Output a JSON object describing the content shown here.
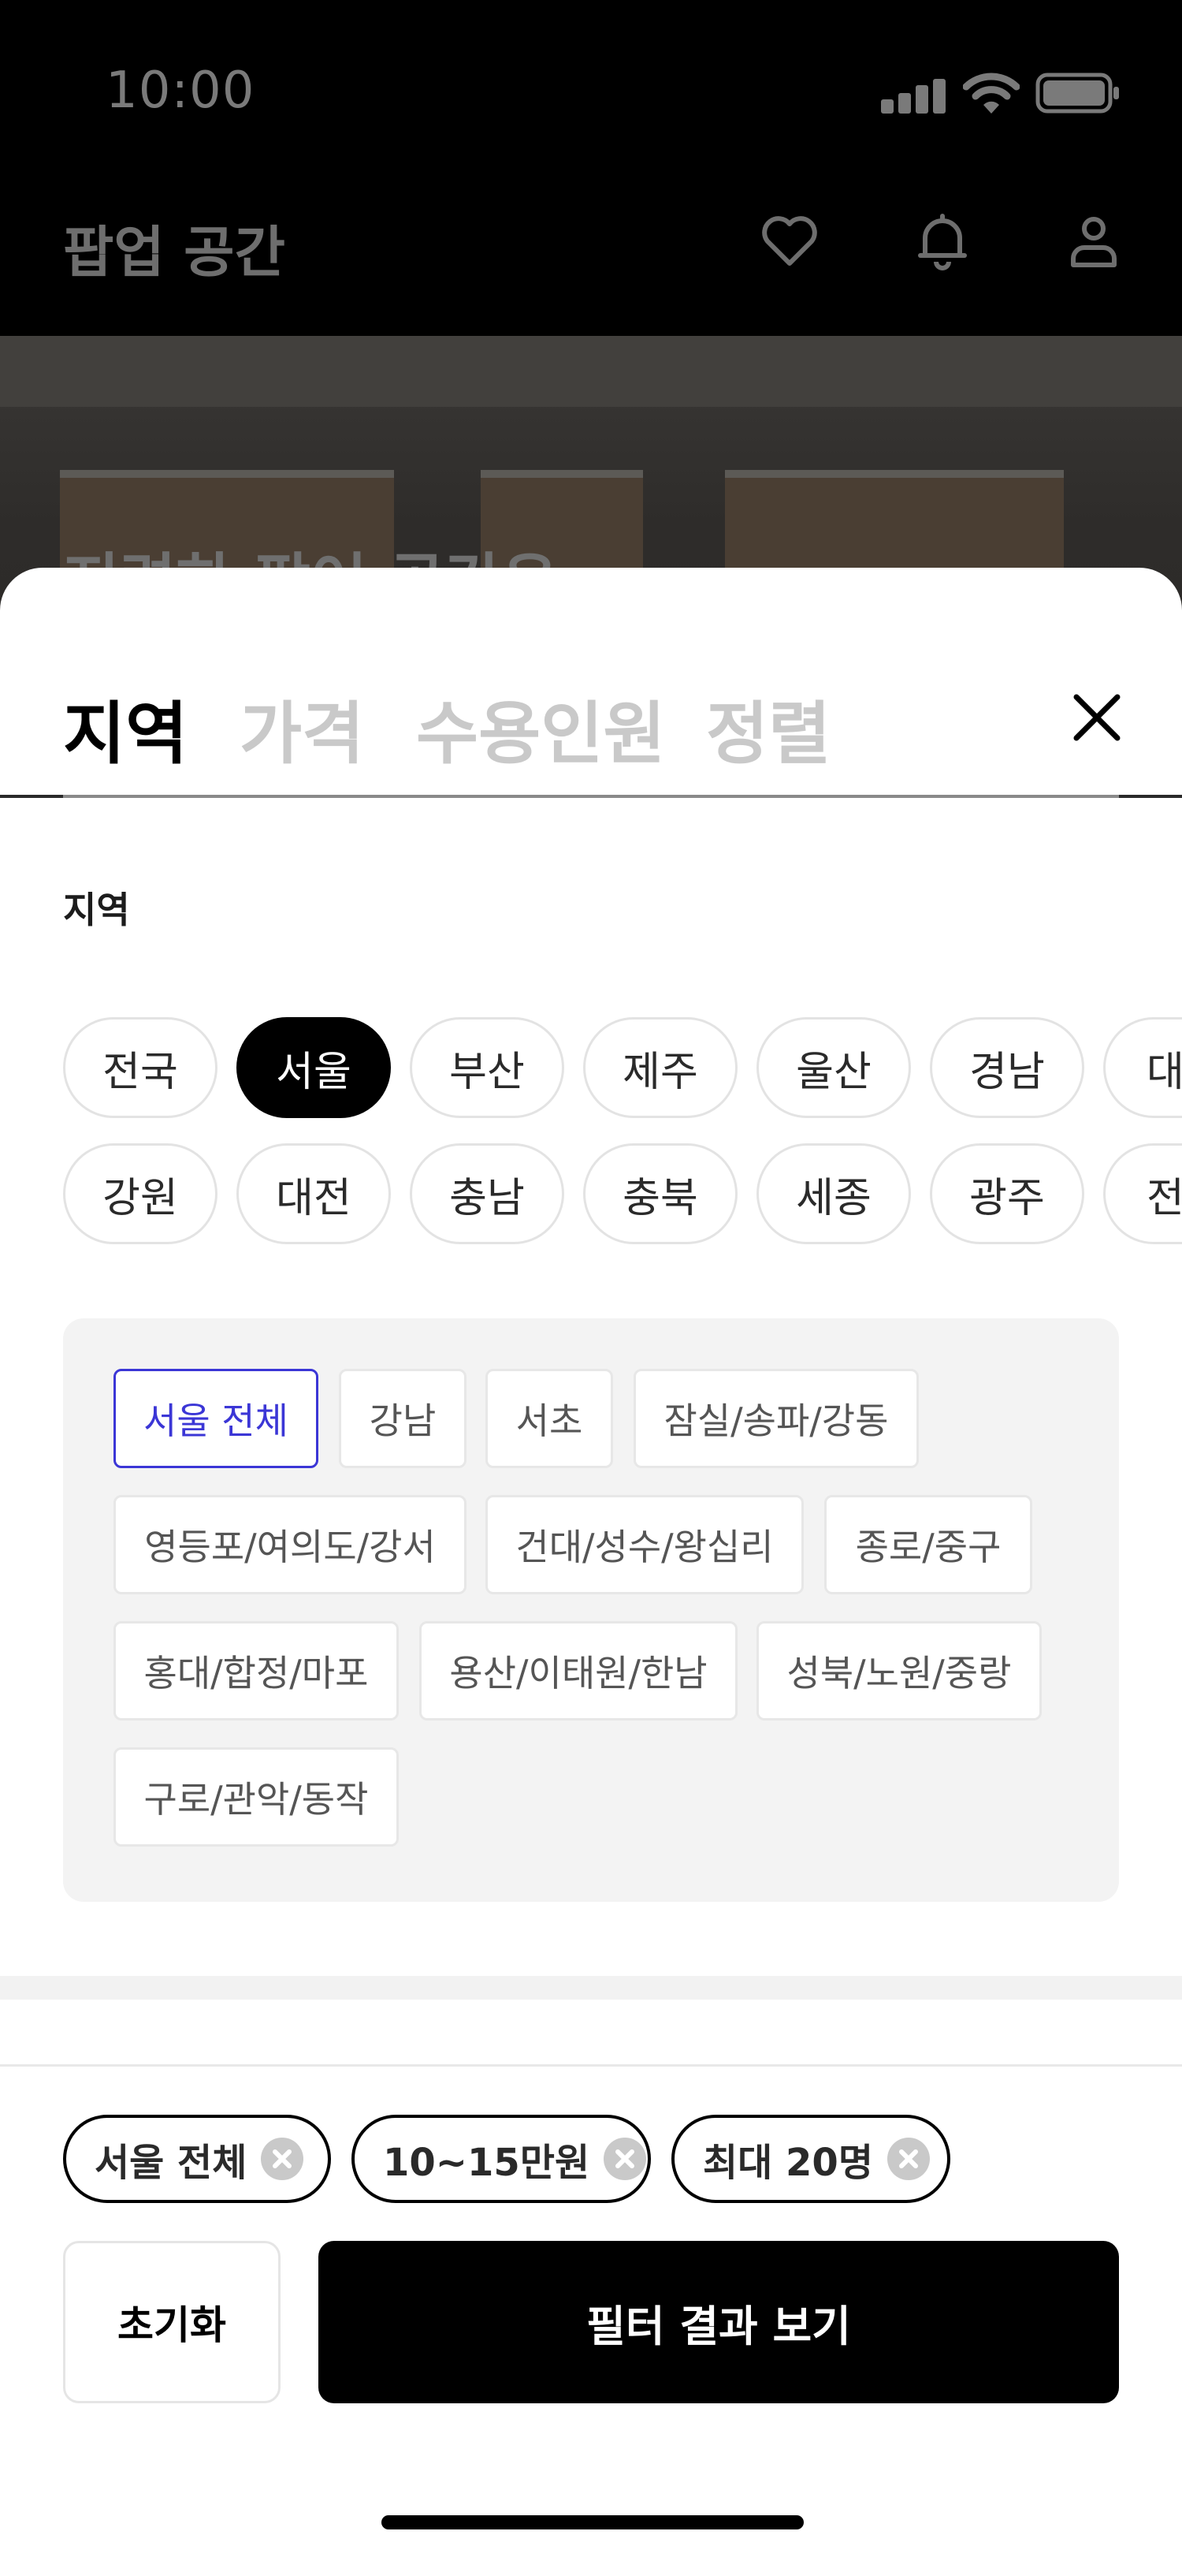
{
  "status_bar": {
    "time": "10:00"
  },
  "header": {
    "title": "팝업 공간"
  },
  "hero": {
    "title": "지련하 팝어 공간은"
  },
  "filter_sheet": {
    "tabs": [
      {
        "label": "지역",
        "active": true
      },
      {
        "label": "가격",
        "active": false
      },
      {
        "label": "수용인원",
        "active": false
      },
      {
        "label": "정렬",
        "active": false
      }
    ],
    "section_label": "지역",
    "regions_row1": [
      "전국",
      "서울",
      "부산",
      "제주",
      "울산",
      "경남",
      "대구"
    ],
    "regions_row2": [
      "강원",
      "대전",
      "충남",
      "충북",
      "세종",
      "광주",
      "전북"
    ],
    "selected_region": "서울",
    "districts": [
      "서울 전체",
      "강남",
      "서초",
      "잠실/송파/강동",
      "영등포/여의도/강서",
      "건대/성수/왕십리",
      "종로/중구",
      "홍대/합정/마포",
      "용산/이태원/한남",
      "성북/노원/중랑",
      "구로/관악/동작"
    ],
    "selected_district": "서울 전체",
    "active_filters": [
      "서울 전체",
      "10~15만원",
      "최대 20명"
    ],
    "reset_label": "초기화",
    "apply_label": "필터 결과 보기"
  },
  "colors": {
    "accent": "#3b36d6",
    "primary": "#000000"
  }
}
